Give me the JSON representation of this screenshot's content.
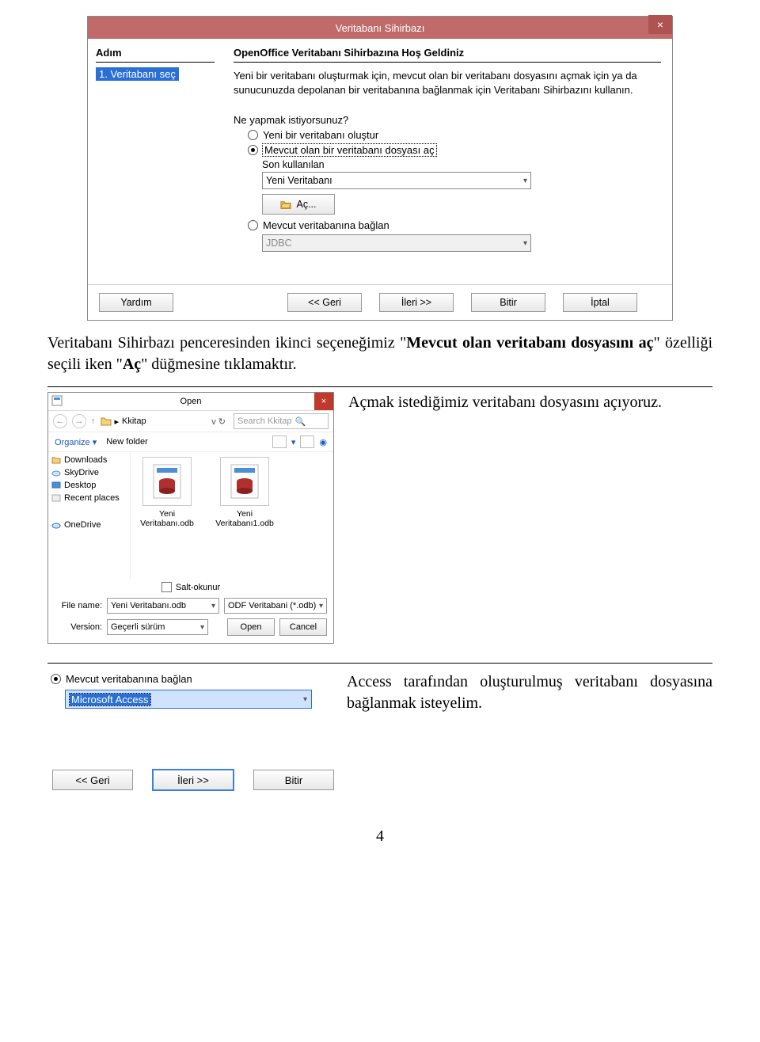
{
  "wizard": {
    "title": "Veritabanı Sihirbazı",
    "steps_header": "Adım",
    "step1": "1. Veritabanı seç",
    "welcome": "OpenOffice Veritabanı Sihirbazına Hoş Geldiniz",
    "intro": "Yeni bir veritabanı oluşturmak için, mevcut olan bir veritabanı dosyasını açmak için ya da sunucunuzda depolanan bir veritabanına bağlanmak için Veritabanı Sihirbazını kullanın.",
    "question": "Ne yapmak istiyorsunuz?",
    "opt_new": "Yeni bir veritabanı oluştur",
    "opt_open": "Mevcut olan bir veritabanı dosyası aç",
    "recent_label": "Son kullanılan",
    "recent_value": "Yeni Veritabanı",
    "open_btn": "Aç...",
    "opt_connect": "Mevcut veritabanına bağlan",
    "connect_value": "JDBC",
    "footer": {
      "help": "Yardım",
      "back": "<< Geri",
      "next": "İleri >>",
      "finish": "Bitir",
      "cancel": "İptal"
    }
  },
  "para1_a": "Veritabanı Sihirbazı penceresinden ikinci seçeneğimiz \"",
  "para1_b": "Mevcut olan veritabanı dosyasını aç",
  "para1_c": "\" özelliği seçili iken \"",
  "para1_d": "Aç",
  "para1_e": "\" düğmesine tıklamaktır.",
  "open": {
    "title": "Open",
    "path": "Kkitap",
    "search": "Search Kkitap",
    "organize": "Organize",
    "newfolder": "New folder",
    "tree": {
      "downloads": "Downloads",
      "skydrive": "SkyDrive",
      "desktop": "Desktop",
      "recent": "Recent places",
      "onedrive": "OneDrive"
    },
    "file1": "Yeni Veritabanı.odb",
    "file2": "Yeni Veritabanı1.odb",
    "readonly": "Salt-okunur",
    "filename_lbl": "File name:",
    "filename_val": "Yeni Veritabanı.odb",
    "filter": "ODF Veritabani (*.odb)",
    "version_lbl": "Version:",
    "version_val": "Geçerli sürüm",
    "open_btn": "Open",
    "cancel_btn": "Cancel"
  },
  "para2": "Açmak istediğimiz veritabanı dosyasını açıyoruz.",
  "panel3": {
    "radio": "Mevcut veritabanına bağlan",
    "value": "Microsoft Access",
    "back": "<< Geri",
    "next": "İleri >>",
    "finish": "Bitir"
  },
  "para3": "Access tarafından oluşturulmuş veritabanı dosyasına bağlanmak isteyelim.",
  "page_num": "4"
}
